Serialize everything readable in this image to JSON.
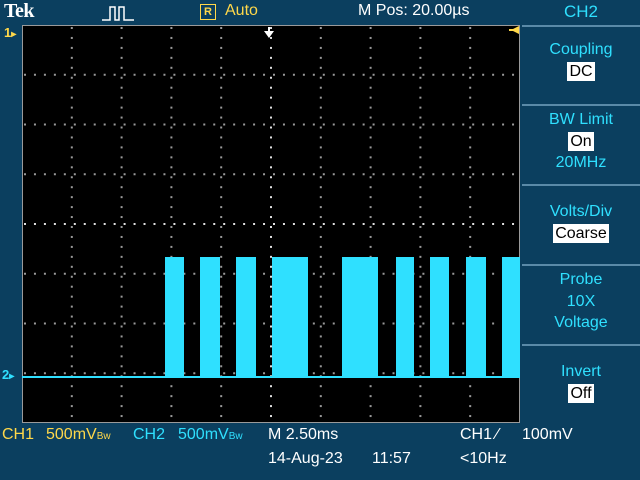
{
  "header": {
    "brand": "Tek",
    "acq_badge": "R",
    "acq_mode": "Auto",
    "m_pos": "M Pos: 20.00µs",
    "trigger_icon": "trigger-pulse-icon"
  },
  "screen": {
    "ch1_marker": "1",
    "ch2_marker": "2",
    "trigger_level_icon": "trigger-level-icon",
    "trigger_pos_icon": "trigger-position-icon"
  },
  "menu": {
    "title": "CH2",
    "coupling_label": "Coupling",
    "coupling_value": "DC",
    "bw_label": "BW Limit",
    "bw_value": "On",
    "bw_freq": "20MHz",
    "voltsdiv_label": "Volts/Div",
    "voltsdiv_value": "Coarse",
    "probe_label": "Probe",
    "probe_atten": "10X",
    "probe_type": "Voltage",
    "invert_label": "Invert",
    "invert_value": "Off"
  },
  "status": {
    "ch1_label": "CH1",
    "ch1_scale": "500mV",
    "ch1_bw": "Bw",
    "ch2_label": "CH2",
    "ch2_scale": "500mV",
    "ch2_bw": "Bw",
    "timebase": "M 2.50ms",
    "date": "14-Aug-23",
    "time": "11:57",
    "trig_source": "CH1",
    "trig_slope": "∕",
    "trig_level": "100mV",
    "trig_freq": "<10Hz"
  },
  "colors": {
    "ch1": "#ffd84a",
    "ch2": "#2fe0ff",
    "background": "#0b3f5f",
    "screen": "#000000"
  }
}
